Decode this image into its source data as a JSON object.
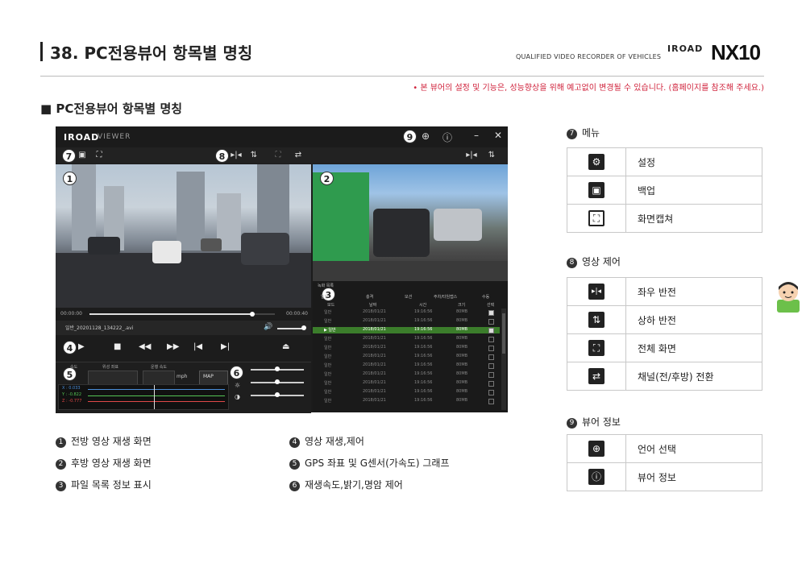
{
  "header": {
    "title": "38. PC전용뷰어 항목별 명칭",
    "brand_sub": "QUALIFIED VIDEO RECORDER OF VEHICLES",
    "brand_logo": "IROAD",
    "brand_model": "NX10"
  },
  "notice": "• 본 뷰어의 설정 및 기능은, 성능향상을 위해 예고없이 변경될 수 있습니다. (홈페이지를 참조해 주세요.)",
  "section_title": "■ PC전용뷰어 항목별 명칭",
  "viewer": {
    "logo": "IROAD",
    "logo_sub": "VIEWER",
    "time_start": "00:00:00",
    "time_end": "00:00:40",
    "seek_fraction": 0.88,
    "file_name": "일반_20201128_134222_.avi",
    "gps_labels": {
      "speed": "속도",
      "coords": "위성 좌표",
      "dir": "운행 속도",
      "unit": "mph",
      "map": "MAP"
    },
    "graph_labels": [
      "X : 0.033",
      "Y : -0.822",
      "Z : -0.777"
    ],
    "list": {
      "tab_label": "녹화 목록",
      "filters": [
        "일반",
        "충격",
        "모션",
        "주차/타임랩스",
        "수동"
      ],
      "columns": [
        "모드",
        "날짜",
        "시간",
        "크기",
        "선택"
      ],
      "rows": [
        {
          "mode": "일반",
          "date": "2018/01/21",
          "time": "19:16:56",
          "size": "80MB",
          "checked": true,
          "selected": false
        },
        {
          "mode": "일반",
          "date": "2018/01/21",
          "time": "19:16:56",
          "size": "80MB",
          "checked": false,
          "selected": false
        },
        {
          "mode": "▶ 일반",
          "date": "2018/01/21",
          "time": "19:16:56",
          "size": "80MB",
          "checked": true,
          "selected": true
        },
        {
          "mode": "일반",
          "date": "2018/01/21",
          "time": "19:16:56",
          "size": "80MB",
          "checked": false,
          "selected": false
        },
        {
          "mode": "일반",
          "date": "2018/01/21",
          "time": "19:16:56",
          "size": "80MB",
          "checked": false,
          "selected": false
        },
        {
          "mode": "일반",
          "date": "2018/01/21",
          "time": "19:16:56",
          "size": "80MB",
          "checked": false,
          "selected": false
        },
        {
          "mode": "일반",
          "date": "2018/01/21",
          "time": "19:16:56",
          "size": "80MB",
          "checked": false,
          "selected": false
        },
        {
          "mode": "일반",
          "date": "2018/01/21",
          "time": "19:16:56",
          "size": "80MB",
          "checked": false,
          "selected": false
        },
        {
          "mode": "일반",
          "date": "2018/01/21",
          "time": "19:16:56",
          "size": "80MB",
          "checked": false,
          "selected": false
        },
        {
          "mode": "일반",
          "date": "2018/01/21",
          "time": "19:16:56",
          "size": "80MB",
          "checked": false,
          "selected": false
        },
        {
          "mode": "일반",
          "date": "2018/01/21",
          "time": "19:16:56",
          "size": "80MB",
          "checked": false,
          "selected": false
        }
      ]
    },
    "badges": [
      "1",
      "2",
      "3",
      "4",
      "5",
      "6",
      "7",
      "8",
      "9"
    ]
  },
  "legend_menu": {
    "num": "7",
    "title": "메뉴",
    "items": [
      {
        "icon": "gear-icon",
        "label": "설정"
      },
      {
        "icon": "save-icon",
        "label": "백업"
      },
      {
        "icon": "capture-icon",
        "label": "화면캡쳐"
      }
    ]
  },
  "legend_video": {
    "num": "8",
    "title": "영상 제어",
    "items": [
      {
        "icon": "flip-horizontal-icon",
        "label": "좌우 반전"
      },
      {
        "icon": "flip-vertical-icon",
        "label": "상하 반전"
      },
      {
        "icon": "fullscreen-icon",
        "label": "전체 화면"
      },
      {
        "icon": "switch-channel-icon",
        "label": "채널(전/후방) 전환"
      }
    ]
  },
  "legend_info": {
    "num": "9",
    "title": "뷰어 정보",
    "items": [
      {
        "icon": "globe-icon",
        "label": "언어 선택"
      },
      {
        "icon": "info-icon",
        "label": "뷰어 정보"
      }
    ]
  },
  "bottom_legend": [
    {
      "num": "1",
      "label": "전방 영상 재생 화면"
    },
    {
      "num": "2",
      "label": "후방 영상 재생 화면"
    },
    {
      "num": "3",
      "label": "파일 목록 정보 표시"
    },
    {
      "num": "4",
      "label": "영상 재생,제어"
    },
    {
      "num": "5",
      "label": "GPS 좌표 및 G센서(가속도) 그래프"
    },
    {
      "num": "6",
      "label": "재생속도,밝기,명암 제어"
    }
  ]
}
